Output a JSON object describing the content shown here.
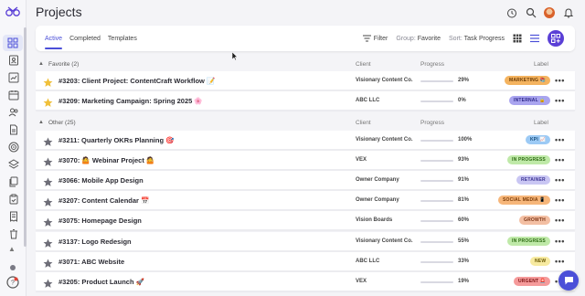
{
  "page": {
    "title": "Projects"
  },
  "tabs": [
    {
      "label": "Active"
    },
    {
      "label": "Completed"
    },
    {
      "label": "Templates"
    }
  ],
  "toolbar": {
    "filter_label": "Filter",
    "group_prefix": "Group:",
    "group_value": "Favorite",
    "sort_prefix": "Sort:",
    "sort_value": "Task Progress"
  },
  "columns": {
    "client": "Client",
    "progress": "Progress",
    "label": "Label"
  },
  "sections": [
    {
      "name": "Favorite (2)",
      "rows": [
        {
          "title": "#3203: Client Project: ContentCraft Workflow 📝",
          "client": "Visionary Content Co.",
          "progress_pct": 29,
          "progress_text": "29%",
          "label": "MARKETING 📚",
          "label_bg": "#f4b35f",
          "label_fg": "#6b3b05",
          "starred": true
        },
        {
          "title": "#3209: Marketing Campaign: Spring 2025 🌸",
          "client": "ABC LLC",
          "progress_pct": 0,
          "progress_text": "0%",
          "label": "INTERNAL 🔒",
          "label_bg": "#a9a4ef",
          "label_fg": "#2f2a8a",
          "starred": true
        }
      ]
    },
    {
      "name": "Other (25)",
      "rows": [
        {
          "title": "#3211: Quarterly OKRs Planning 🎯",
          "client": "Visionary Content Co.",
          "progress_pct": 100,
          "progress_text": "100%",
          "label": "KPI 📈",
          "label_bg": "#9ccaf5",
          "label_fg": "#134a7a",
          "starred": false
        },
        {
          "title": "#3070: 🤷 Webinar Project 🤷",
          "client": "VEX",
          "progress_pct": 93,
          "progress_text": "93%",
          "label": "IN PROGRESS",
          "label_bg": "#bfe9a8",
          "label_fg": "#2c6b12",
          "starred": false
        },
        {
          "title": "#3066: Mobile App Design",
          "client": "Owner Company",
          "progress_pct": 91,
          "progress_text": "91%",
          "label": "RETAINER",
          "label_bg": "#c9c6f3",
          "label_fg": "#3c3494",
          "starred": false
        },
        {
          "title": "#3207: Content Calendar 📅",
          "client": "Owner Company",
          "progress_pct": 81,
          "progress_text": "81%",
          "label": "SOCIAL MEDIA 📱",
          "label_bg": "#f6b67a",
          "label_fg": "#7a3a06",
          "starred": false
        },
        {
          "title": "#3075: Homepage Design",
          "client": "Vision Boards",
          "progress_pct": 60,
          "progress_text": "60%",
          "label": "GROWTH",
          "label_bg": "#f3bfa3",
          "label_fg": "#7d3515",
          "starred": false
        },
        {
          "title": "#3137: Logo Redesign",
          "client": "Visionary Content Co.",
          "progress_pct": 55,
          "progress_text": "55%",
          "label": "IN PROGRESS",
          "label_bg": "#bfe9a8",
          "label_fg": "#2c6b12",
          "starred": false
        },
        {
          "title": "#3071: ABC Website",
          "client": "ABC LLC",
          "progress_pct": 33,
          "progress_text": "33%",
          "label": "NEW",
          "label_bg": "#f7eaa0",
          "label_fg": "#6b5a05",
          "starred": false
        },
        {
          "title": "#3205: Product Launch 🚀",
          "client": "VEX",
          "progress_pct": 19,
          "progress_text": "19%",
          "label": "URGENT 🚨",
          "label_bg": "#f59a9a",
          "label_fg": "#7d1414",
          "starred": false
        }
      ]
    }
  ],
  "icons": {
    "sidebar": [
      "dashboard-icon",
      "contacts-icon",
      "chart-icon",
      "calendar-icon",
      "users-icon",
      "document-icon",
      "target-icon",
      "layers-icon",
      "copy-icon",
      "clipboard-icon",
      "invoice-icon",
      "trash-icon"
    ],
    "header": [
      "timer-icon",
      "search-icon",
      "avatar",
      "bell-icon"
    ]
  },
  "colors": {
    "accent": "#4b4fd8",
    "progress_fill": "#3b3fd1",
    "star_gold": "#f0c03a",
    "star_grey": "#6e6e78",
    "fab": "#5a3fd6"
  }
}
